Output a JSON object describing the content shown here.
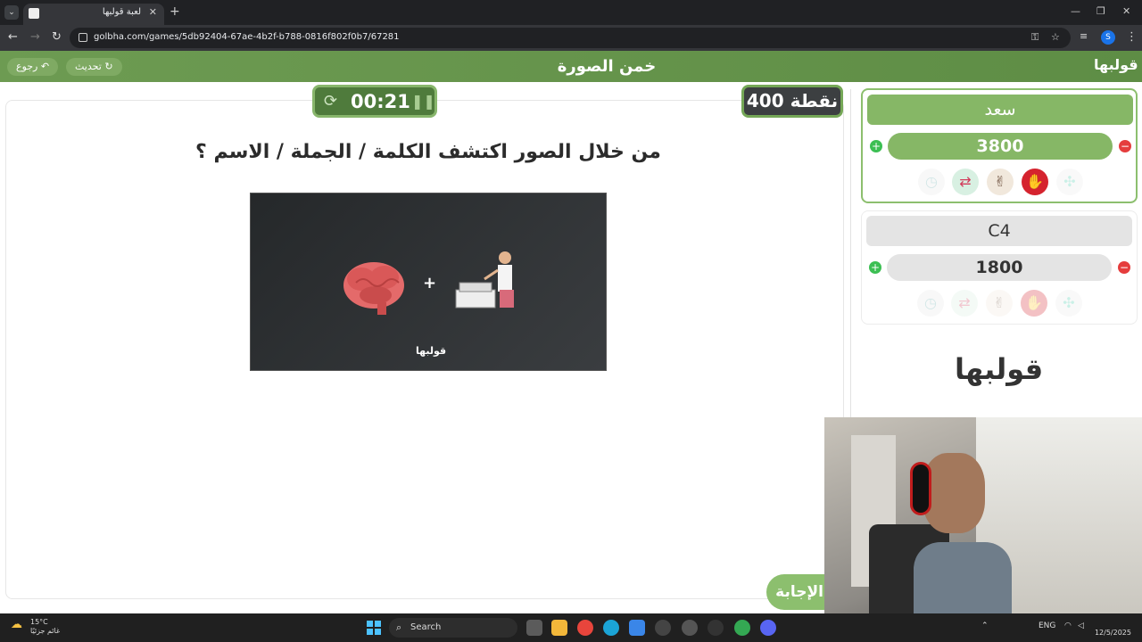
{
  "browser": {
    "tab_title": "لعبة قولبها",
    "url": "golbha.com/games/5db92404-67ae-4b2f-b788-0816f802f0b7/67281",
    "profile_initial": "S"
  },
  "header": {
    "title": "خمن الصورة",
    "back_label": "رجوع",
    "refresh_label": "تحديث",
    "brand": "قولبها"
  },
  "game": {
    "timer": "00:21",
    "points": "400 نقطة",
    "question": "من خلال الصور اكتشف الكلمة / الجملة / الاسم ؟",
    "puzzle_plus": "+",
    "puzzle_brand": "قولبها",
    "answer_label": "الإجابة"
  },
  "players": [
    {
      "name": "سعد",
      "score": "3800"
    },
    {
      "name": "C4",
      "score": "1800"
    }
  ],
  "sidebar": {
    "logo": "قولبها"
  },
  "taskbar": {
    "temperature": "15°C",
    "weather_text": "غائم جزئيًا",
    "search_placeholder": "Search",
    "language": "ENG",
    "date": "12/5/2025"
  }
}
